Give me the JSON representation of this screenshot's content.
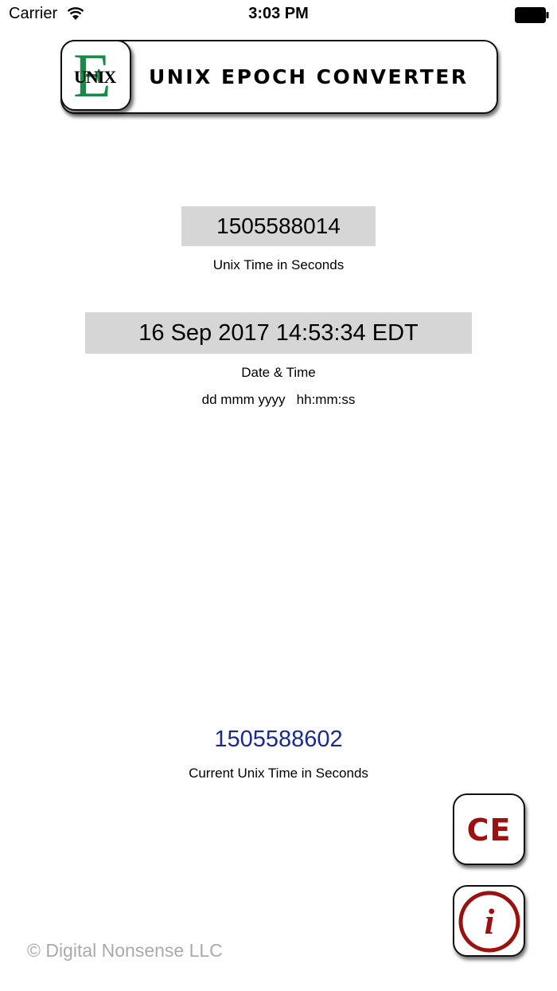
{
  "status_bar": {
    "carrier": "Carrier",
    "time": "3:03 PM"
  },
  "header": {
    "logo_big": "E",
    "logo_small": "UNIX",
    "title": "UNIX EPOCH CONVERTER"
  },
  "unix": {
    "value": "1505588014",
    "label": "Unix Time in Seconds"
  },
  "date": {
    "value": "16 Sep 2017 14:53:34 EDT",
    "label": "Date & Time",
    "format_label": "dd mmm yyyy   hh:mm:ss"
  },
  "current": {
    "value": "1505588602",
    "label": "Current Unix Time in Seconds"
  },
  "buttons": {
    "ce_label": "CE",
    "info_label": "i"
  },
  "footer": {
    "copyright": "© Digital Nonsense LLC"
  },
  "colors": {
    "accent_blue": "#1a2a8f",
    "ce_red": "#9c1010",
    "logo_green": "#1a8a4a",
    "box_gray": "#d6d6d6"
  }
}
